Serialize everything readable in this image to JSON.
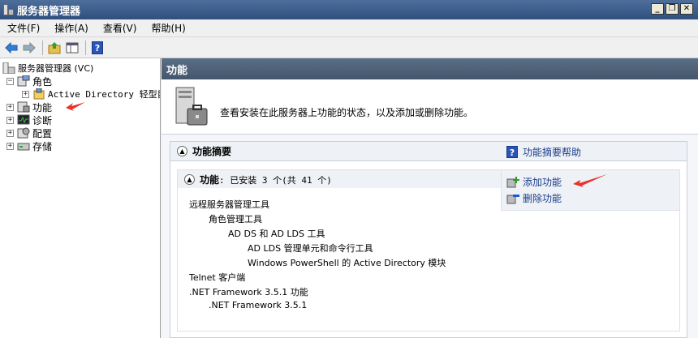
{
  "window": {
    "title": "服务器管理器"
  },
  "menu": [
    "文件(F)",
    "操作(A)",
    "查看(V)",
    "帮助(H)"
  ],
  "tree": {
    "root": "服务器管理器 (VC)",
    "items": [
      {
        "label": "角色",
        "expander": "⊟"
      },
      {
        "label": "Active Directory 轻型目录服务",
        "expander": "⊞"
      },
      {
        "label": "功能",
        "expander": "⊞"
      },
      {
        "label": "诊断",
        "expander": "⊞"
      },
      {
        "label": "配置",
        "expander": "⊞"
      },
      {
        "label": "存储",
        "expander": "⊞"
      }
    ]
  },
  "main": {
    "header": "功能",
    "intro": "查看安装在此服务器上功能的状态，以及添加或删除功能。",
    "summary": {
      "title": "功能摘要",
      "help_link": "功能摘要帮助",
      "features_title": "功能",
      "features_status": ": 已安装 3 个(共 41 个)",
      "actions": [
        "添加功能",
        "删除功能"
      ],
      "features": [
        "远程服务器管理工具",
        "角色管理工具",
        "AD DS 和 AD LDS 工具",
        "AD LDS 管理单元和命令行工具",
        "Windows PowerShell 的 Active Directory 模块",
        "Telnet 客户端",
        ".NET Framework 3.5.1 功能",
        ".NET Framework 3.5.1"
      ]
    }
  },
  "colors": {
    "accent_arrow": "#e8332a",
    "link": "#1a3e8c",
    "header_bg": "#4f627a"
  }
}
